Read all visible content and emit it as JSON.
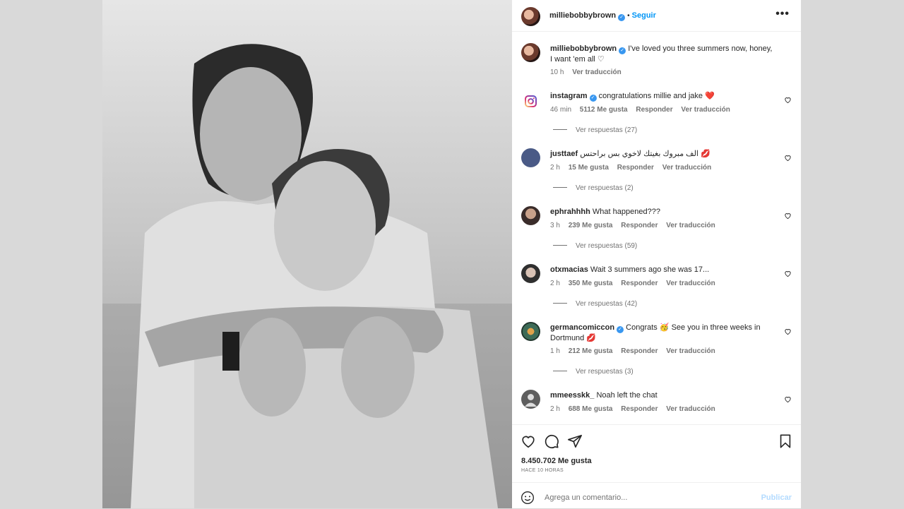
{
  "post": {
    "author": "milliebobbybrown",
    "follow_label": "Seguir",
    "more_label": "•••",
    "caption": "I've loved you three summers now, honey, I want 'em all ♡",
    "caption_time": "10 h",
    "caption_translate": "Ver traducción"
  },
  "comments": [
    {
      "user": "instagram",
      "verified": true,
      "text": "congratulations millie and jake ❤️",
      "time": "46 min",
      "likes": "5112 Me gusta",
      "reply": "Responder",
      "translate": "Ver traducción",
      "replies": "Ver respuestas (27)"
    },
    {
      "user": "justtaef",
      "verified": false,
      "text": "الف مبروك بغيتك لاخوي بس براحتس 💋",
      "time": "2 h",
      "likes": "15 Me gusta",
      "reply": "Responder",
      "translate": "Ver traducción",
      "replies": "Ver respuestas (2)"
    },
    {
      "user": "ephrahhhh",
      "verified": false,
      "text": "What happened???",
      "time": "3 h",
      "likes": "239 Me gusta",
      "reply": "Responder",
      "translate": "Ver traducción",
      "replies": "Ver respuestas (59)"
    },
    {
      "user": "otxmacias",
      "verified": false,
      "text": "Wait 3 summers ago she was 17...",
      "time": "2 h",
      "likes": "350 Me gusta",
      "reply": "Responder",
      "translate": "Ver traducción",
      "replies": "Ver respuestas (42)"
    },
    {
      "user": "germancomiccon",
      "verified": true,
      "text": "Congrats 🥳 See you in three weeks in Dortmund 💋",
      "time": "1 h",
      "likes": "212 Me gusta",
      "reply": "Responder",
      "translate": "Ver traducción",
      "replies": "Ver respuestas (3)"
    },
    {
      "user": "mmeesskk_",
      "verified": false,
      "text": "Noah left the chat",
      "time": "2 h",
      "likes": "688 Me gusta",
      "reply": "Responder",
      "translate": "Ver traducción",
      "replies": ""
    }
  ],
  "actions": {
    "likes": "8.450.702 Me gusta",
    "time_ago": "HACE 10 HORAS"
  },
  "composer": {
    "placeholder": "Agrega un comentario...",
    "post_label": "Publicar"
  },
  "colors": {
    "link": "#0095f6",
    "verified": "#3897f0",
    "muted": "#737373"
  }
}
